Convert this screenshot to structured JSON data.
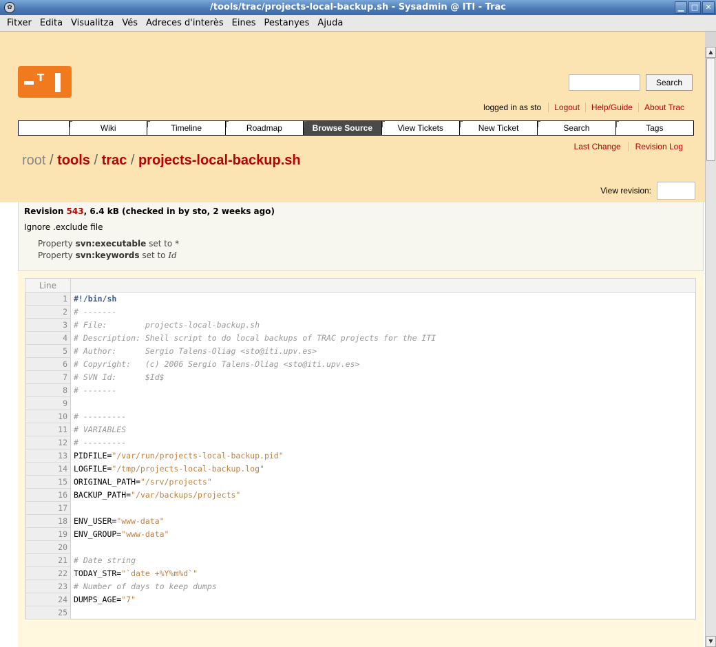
{
  "window": {
    "title": "/tools/trac/projects-local-backup.sh - Sysadmin @ ITI - Trac"
  },
  "menu": [
    "Fitxer",
    "Edita",
    "Visualitza",
    "Vés",
    "Adreces d'interès",
    "Eines",
    "Pestanyes",
    "Ajuda"
  ],
  "header": {
    "search_button": "Search",
    "logged_in": "logged in as sto",
    "meta_links": [
      "Logout",
      "Help/Guide",
      "About Trac"
    ]
  },
  "mainnav": [
    "Wiki",
    "Timeline",
    "Roadmap",
    "Browse Source",
    "View Tickets",
    "New Ticket",
    "Search",
    "Tags"
  ],
  "mainnav_active": "Browse Source",
  "ctxnav": [
    "Last Change",
    "Revision Log"
  ],
  "path": {
    "root": "root",
    "sep": " / ",
    "segments": [
      "tools",
      "trac",
      "projects-local-backup.sh"
    ]
  },
  "view_revision_label": "View revision:",
  "info": {
    "revision_word": "Revision",
    "revision_num": "543",
    "revision_rest": ", 6.4 kB (checked in by sto, 2 weeks ago)",
    "message": "Ignore .exclude file",
    "prop1_pre": "Property ",
    "prop1_name": "svn:executable",
    "prop1_post": " set to *",
    "prop2_pre": "Property ",
    "prop2_name": "svn:keywords",
    "prop2_mid": " set to ",
    "prop2_val": "Id"
  },
  "code": {
    "line_header": "Line",
    "lines": [
      {
        "n": "1",
        "parts": [
          {
            "t": "#!/bin/sh",
            "c": "shebang"
          }
        ]
      },
      {
        "n": "2",
        "parts": [
          {
            "t": "# -------",
            "c": "cmt"
          }
        ]
      },
      {
        "n": "3",
        "parts": [
          {
            "t": "# File:        projects-local-backup.sh",
            "c": "cmt"
          }
        ]
      },
      {
        "n": "4",
        "parts": [
          {
            "t": "# Description: Shell script to do local backups of TRAC projects for the ITI",
            "c": "cmt"
          }
        ]
      },
      {
        "n": "5",
        "parts": [
          {
            "t": "# Author:      Sergio Talens-Oliag <sto@iti.upv.es>",
            "c": "cmt"
          }
        ]
      },
      {
        "n": "6",
        "parts": [
          {
            "t": "# Copyright:   (c) 2006 Sergio Talens-Oliag <sto@iti.upv.es>",
            "c": "cmt"
          }
        ]
      },
      {
        "n": "7",
        "parts": [
          {
            "t": "# SVN Id:      $Id$",
            "c": "cmt"
          }
        ]
      },
      {
        "n": "8",
        "parts": [
          {
            "t": "# -------",
            "c": "cmt"
          }
        ]
      },
      {
        "n": "9",
        "parts": []
      },
      {
        "n": "10",
        "parts": [
          {
            "t": "# ---------",
            "c": "cmt"
          }
        ]
      },
      {
        "n": "11",
        "parts": [
          {
            "t": "# VARIABLES",
            "c": "cmt"
          }
        ]
      },
      {
        "n": "12",
        "parts": [
          {
            "t": "# ---------",
            "c": "cmt"
          }
        ]
      },
      {
        "n": "13",
        "parts": [
          {
            "t": "PIDFILE=",
            "c": "kw"
          },
          {
            "t": "\"/var/run/projects-local-backup.pid\"",
            "c": "str"
          }
        ]
      },
      {
        "n": "14",
        "parts": [
          {
            "t": "LOGFILE=",
            "c": "kw"
          },
          {
            "t": "\"/tmp/projects-local-backup.log\"",
            "c": "str"
          }
        ]
      },
      {
        "n": "15",
        "parts": [
          {
            "t": "ORIGINAL_PATH=",
            "c": "kw"
          },
          {
            "t": "\"/srv/projects\"",
            "c": "str"
          }
        ]
      },
      {
        "n": "16",
        "parts": [
          {
            "t": "BACKUP_PATH=",
            "c": "kw"
          },
          {
            "t": "\"/var/backups/projects\"",
            "c": "str"
          }
        ]
      },
      {
        "n": "17",
        "parts": []
      },
      {
        "n": "18",
        "parts": [
          {
            "t": "ENV_USER=",
            "c": "kw"
          },
          {
            "t": "\"www-data\"",
            "c": "str"
          }
        ]
      },
      {
        "n": "19",
        "parts": [
          {
            "t": "ENV_GROUP=",
            "c": "kw"
          },
          {
            "t": "\"www-data\"",
            "c": "str"
          }
        ]
      },
      {
        "n": "20",
        "parts": []
      },
      {
        "n": "21",
        "parts": [
          {
            "t": "# Date string",
            "c": "cmt"
          }
        ]
      },
      {
        "n": "22",
        "parts": [
          {
            "t": "TODAY_STR=",
            "c": "kw"
          },
          {
            "t": "\"`date +%Y%m%d`\"",
            "c": "str"
          }
        ]
      },
      {
        "n": "23",
        "parts": [
          {
            "t": "# Number of days to keep dumps",
            "c": "cmt"
          }
        ]
      },
      {
        "n": "24",
        "parts": [
          {
            "t": "DUMPS_AGE=",
            "c": "kw"
          },
          {
            "t": "\"7\"",
            "c": "str"
          }
        ]
      },
      {
        "n": "25",
        "parts": []
      }
    ]
  }
}
